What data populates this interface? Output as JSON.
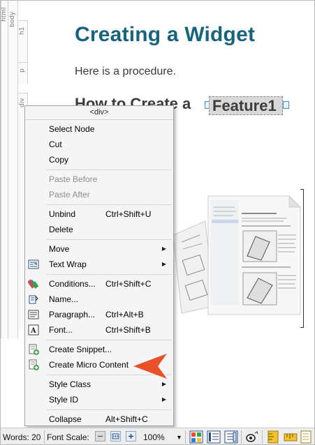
{
  "structure_bars": {
    "html": "html",
    "body": "body",
    "h1": "h1",
    "p": "p",
    "div": "div"
  },
  "document": {
    "title": "Creating a Widget",
    "paragraph": "Here is a procedure.",
    "heading_prefix": "How to Create a",
    "variable": "Feature1"
  },
  "context_menu": {
    "header": "<div>",
    "items": {
      "select_node": "Select Node",
      "cut": "Cut",
      "copy": "Copy",
      "paste_before": "Paste Before",
      "paste_after": "Paste After",
      "unbind": "Unbind",
      "unbind_shortcut": "Ctrl+Shift+U",
      "delete": "Delete",
      "move": "Move",
      "text_wrap": "Text Wrap",
      "conditions": "Conditions...",
      "conditions_shortcut": "Ctrl+Shift+C",
      "name": "Name...",
      "paragraph": "Paragraph...",
      "paragraph_shortcut": "Ctrl+Alt+B",
      "font": "Font...",
      "font_shortcut": "Ctrl+Shift+B",
      "create_snippet": "Create Snippet...",
      "create_micro_content": "Create Micro Content",
      "style_class": "Style Class",
      "style_id": "Style ID",
      "collapse": "Collapse",
      "collapse_shortcut": "Alt+Shift+C"
    }
  },
  "status_bar": {
    "words": "Words: 20",
    "font_scale": "Font Scale:",
    "zoom": "100%"
  },
  "colors": {
    "title": "#17647e",
    "pointer": "#e8512a"
  }
}
